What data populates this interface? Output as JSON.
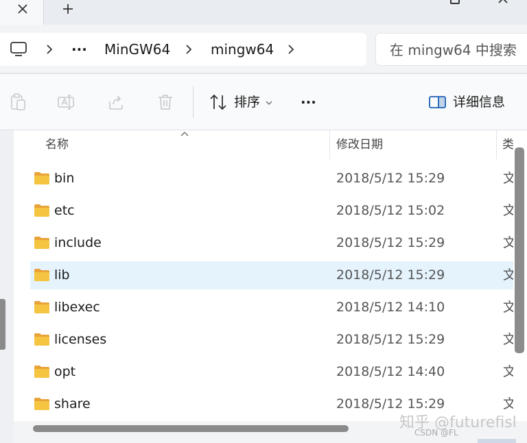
{
  "window": {
    "tab_close_icon": "close-icon",
    "tab_new_icon": "plus-icon",
    "maximize_icon": "maximize-icon",
    "close_icon": "close-icon"
  },
  "address": {
    "home_icon": "monitor-icon",
    "more_label": "···",
    "crumbs": [
      "MinGW64",
      "mingw64"
    ],
    "search_placeholder": "在 mingw64 中搜索"
  },
  "toolbar": {
    "sort_label": "排序",
    "more_label": "···",
    "details_label": "详细信息"
  },
  "columns": {
    "name": "名称",
    "date": "修改日期",
    "type": "类"
  },
  "files": [
    {
      "name": "bin",
      "date": "2018/5/12 15:29",
      "type": "文"
    },
    {
      "name": "etc",
      "date": "2018/5/12 15:02",
      "type": "文"
    },
    {
      "name": "include",
      "date": "2018/5/12 15:29",
      "type": "文"
    },
    {
      "name": "lib",
      "date": "2018/5/12 15:29",
      "type": "文",
      "selected": true
    },
    {
      "name": "libexec",
      "date": "2018/5/12 14:10",
      "type": "文"
    },
    {
      "name": "licenses",
      "date": "2018/5/12 15:29",
      "type": "文"
    },
    {
      "name": "opt",
      "date": "2018/5/12 14:40",
      "type": "文"
    },
    {
      "name": "share",
      "date": "2018/5/12 15:29",
      "type": "文"
    }
  ],
  "watermark": {
    "main": "知乎 @futurefisl",
    "csdn": "CSDN @FL"
  },
  "colors": {
    "selected_row": "#e5f3fd",
    "folder": "#f5c542"
  }
}
